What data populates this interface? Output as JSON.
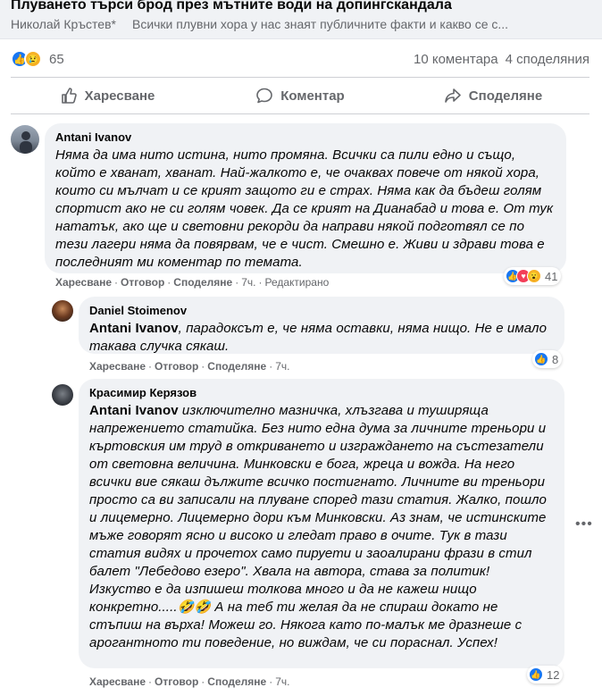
{
  "post": {
    "title": "Плуването търси брод през мътните води на допингскандала",
    "author": "Николай Кръстев*",
    "excerpt": "Всички плувни хора у нас знаят публичните факти и какво се с..."
  },
  "stats": {
    "reactions_count": "65",
    "comments": "10 коментара",
    "shares": "4 споделяния",
    "icons": [
      "like-icon",
      "sad-icon"
    ]
  },
  "actions": {
    "like": "Харесване",
    "comment": "Коментар",
    "share": "Споделяне"
  },
  "comments": [
    {
      "author": "Antani Ivanov",
      "text": "Няма да има нито истина, нито промяна. Всички са пили едно и също, който е хванат, хванат. Най-жалкото е, че очаквах повече от някой хора, които си мълчат и се крият защото ги е страх. Няма как да бъдеш голям спортист ако не си голям човек. Да се крият на Дианабад и това е. От тук нататък, ако ще и световни рекорди да направи някой подготвял се по тези лагери няма да повярвам, че е чист. Смешно е. Живи и здрави това е последният ми коментар по темата.",
      "like": "Харесване",
      "reply": "Отговор",
      "share": "Споделяне",
      "time": "7ч.",
      "edited": "Редактирано",
      "reactions": "41"
    },
    {
      "author": "Daniel Stoimenov",
      "mention": "Antani Ivanov",
      "text": ", парадоксът е, че няма оставки, няма нищо. Не е имало такава случка сякаш.",
      "like": "Харесване",
      "reply": "Отговор",
      "share": "Споделяне",
      "time": "7ч.",
      "reactions": "8"
    },
    {
      "author": "Красимир Керязов",
      "mention": "Antani Ivanov",
      "text": " изключително мазничка, хлъзгава и туширяща напрежението статийка. Без нито една дума за личните треньори и къртовския им труд в откриването и изграждането на състезатели от световна величина. Минковски е бога, жреца и вожда. На него всички вие сякаш дължите всичко постигнато. Личните ви треньори просто са ви записали на плуване според тази статия. Жалко, пошло и лицемерно. Лицемерно дори към Минковски. Аз знам, че истинските мъже говорят ясно и високо и гледат право в очите. Тук в тази статия видях и прочетох само пируети и заоалирани фрази в стил балет \"Лебедово езеро\". Хвала на автора, става за политик! Изкуство е да изпишеш толкова много и да не кажеш нищо конкретно.....🤣🤣 А на теб ти желая да не спираш докато не стъпиш на върха! Можеш го. Някога като по-малък ме дразнеше с арогантното ти поведение, но виждам, че си пораснал. Успех!",
      "like": "Харесване",
      "reply": "Отговор",
      "share": "Споделяне",
      "time": "7ч.",
      "reactions": "12"
    }
  ],
  "colors": {
    "accent": "#1877f2",
    "bubble": "#f0f2f5",
    "muted": "#65676b"
  }
}
